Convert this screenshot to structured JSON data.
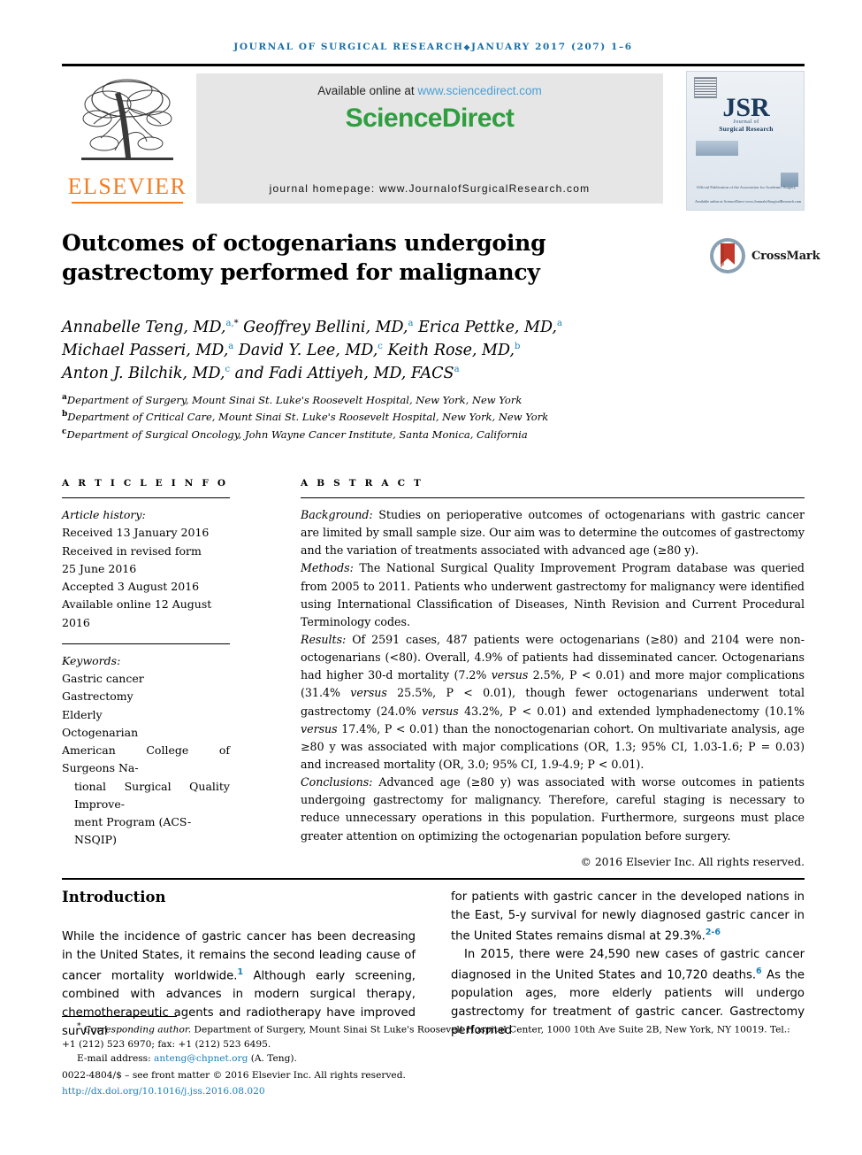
{
  "running_head": {
    "text_before": "JOURNAL OF SURGICAL RESEARCH",
    "diamond": "◆",
    "text_after": "JANUARY 2017 (207) 1–6"
  },
  "masthead": {
    "available_text": "Available online at",
    "sciencedirect_url": "www.sciencedirect.com",
    "sciencedirect_logo": "ScienceDirect",
    "journal_homepage": "journal homepage: www.JournalofSurgicalResearch.com",
    "elsevier_name": "ELSEVIER",
    "cover": {
      "acronym": "JSR",
      "sub_small": "Journal of",
      "sub_line": "Surgical Research",
      "association": "Official Publication of the\nAssociation for Academic Surgery",
      "footer": "Available online at ScienceDirect\nwww.JournalofSurgicalResearch.com"
    }
  },
  "article": {
    "title": "Outcomes of octogenarians undergoing gastrectomy performed for malignancy",
    "crossmark_label": "CrossMark",
    "authors_line1_a": "Annabelle Teng, MD,",
    "authors_line1_sup1": "a,",
    "authors_line1_star": "*",
    "authors_line1_b": " Geoffrey Bellini, MD,",
    "authors_line1_sup2": "a",
    "authors_line1_c": " Erica Pettke, MD,",
    "authors_line1_sup3": "a",
    "authors_line2_a": "Michael Passeri, MD,",
    "authors_line2_sup1": "a",
    "authors_line2_b": " David Y. Lee, MD,",
    "authors_line2_sup2": "c",
    "authors_line2_c": " Keith Rose, MD,",
    "authors_line2_sup3": "b",
    "authors_line3_a": "Anton J. Bilchik, MD,",
    "authors_line3_sup1": "c",
    "authors_line3_b": " and Fadi Attiyeh, MD, FACS",
    "authors_line3_sup2": "a",
    "affiliations": [
      {
        "marker": "a",
        "text": "Department of Surgery, Mount Sinai St. Luke's Roosevelt Hospital, New York, New York"
      },
      {
        "marker": "b",
        "text": "Department of Critical Care, Mount Sinai St. Luke's Roosevelt Hospital, New York, New York"
      },
      {
        "marker": "c",
        "text": "Department of Surgical Oncology, John Wayne Cancer Institute, Santa Monica, California"
      }
    ]
  },
  "article_info": {
    "heading": "A R T I C L E  I N F O",
    "history_label": "Article history:",
    "history": [
      "Received 13 January 2016",
      "Received in revised form",
      "25 June 2016",
      "Accepted 3 August 2016",
      "Available online 12 August 2016"
    ],
    "keywords_label": "Keywords:",
    "keywords": [
      "Gastric cancer",
      "Gastrectomy",
      "Elderly",
      "Octogenarian"
    ],
    "keyword_long_line1": "American College of Surgeons Na-",
    "keyword_long_line2": "tional Surgical Quality Improve-",
    "keyword_long_line3": "ment Program (ACS-NSQIP)"
  },
  "abstract": {
    "heading": "A B S T R A C T",
    "background_label": "Background:",
    "background_text": " Studies on perioperative outcomes of octogenarians with gastric cancer are limited by small sample size. Our aim was to determine the outcomes of gastrectomy and the variation of treatments associated with advanced age (≥80 y).",
    "methods_label": "Methods:",
    "methods_text": " The National Surgical Quality Improvement Program database was queried from 2005 to 2011. Patients who underwent gastrectomy for malignancy were identified using International Classification of Diseases, Ninth Revision and Current Procedural Terminology codes.",
    "results_label": "Results:",
    "results_p1": " Of 2591 cases, 487 patients were octogenarians (≥80) and 2104 were non-octogenarians (<80). Overall, 4.9% of patients had disseminated cancer. Octogenarians had higher 30-d mortality (7.2% ",
    "results_em1": "versus",
    "results_p2": " 2.5%, P < 0.01) and more major complications (31.4% ",
    "results_em2": "versus",
    "results_p3": " 25.5%, P < 0.01), though fewer octogenarians underwent total gastrectomy (24.0% ",
    "results_em3": "versus",
    "results_p4": " 43.2%, P < 0.01) and extended lymphadenectomy (10.1% ",
    "results_em4": "versus",
    "results_p5": " 17.4%, P < 0.01) than the nonoctogenarian cohort. On multivariate analysis, age ≥80 y was associated with major complications (OR, 1.3; 95% CI, 1.03-1.6; P = 0.03) and increased mortality (OR, 3.0; 95% CI, 1.9-4.9; P < 0.01).",
    "conclusions_label": "Conclusions:",
    "conclusions_text": " Advanced age (≥80 y) was associated with worse outcomes in patients undergoing gastrectomy for malignancy. Therefore, careful staging is necessary to reduce unnecessary operations in this population. Furthermore, surgeons must place greater attention on optimizing the octogenarian population before surgery.",
    "copyright": "© 2016 Elsevier Inc. All rights reserved."
  },
  "body": {
    "intro_heading": "Introduction",
    "left_p1_a": "While the incidence of gastric cancer has been decreasing in the United States, it remains the second leading cause of cancer mortality worldwide.",
    "left_p1_ref": "1",
    "left_p1_b": " Although early screening, combined with advances in modern surgical therapy, chemotherapeutic agents and radiotherapy have improved survival",
    "right_p1_a": "for patients with gastric cancer in the developed nations in the East, 5-y survival for newly diagnosed gastric cancer in the United States remains dismal at 29.3%.",
    "right_p1_ref": "2-6",
    "right_p2_a": "In 2015, there were 24,590 new cases of gastric cancer diagnosed in the United States and 10,720 deaths.",
    "right_p2_ref": "6",
    "right_p2_b": " As the population ages, more elderly patients will undergo gastrectomy for treatment of gastric cancer. Gastrectomy performed"
  },
  "footnotes": {
    "star": "*",
    "corresponding_label": "Corresponding author.",
    "corresponding_text": " Department of Surgery, Mount Sinai St Luke's Roosevelt Hospital Center, 1000 10th Ave Suite 2B, New York, NY 10019. Tel.: +1 (212) 523 6970; fax: +1 (212) 523 6495.",
    "email_label": "E-mail address:",
    "email": "anteng@chpnet.org",
    "email_attrib": " (A. Teng).",
    "issn_line": "0022-4804/$ – see front matter © 2016 Elsevier Inc. All rights reserved.",
    "doi": "http://dx.doi.org/10.1016/j.jss.2016.08.020"
  },
  "colors": {
    "link_blue": "#1a7fb8",
    "sciencedirect_green": "#2e9e3e",
    "elsevier_orange": "#f47c20",
    "crossmark_red": "#c0392b"
  }
}
